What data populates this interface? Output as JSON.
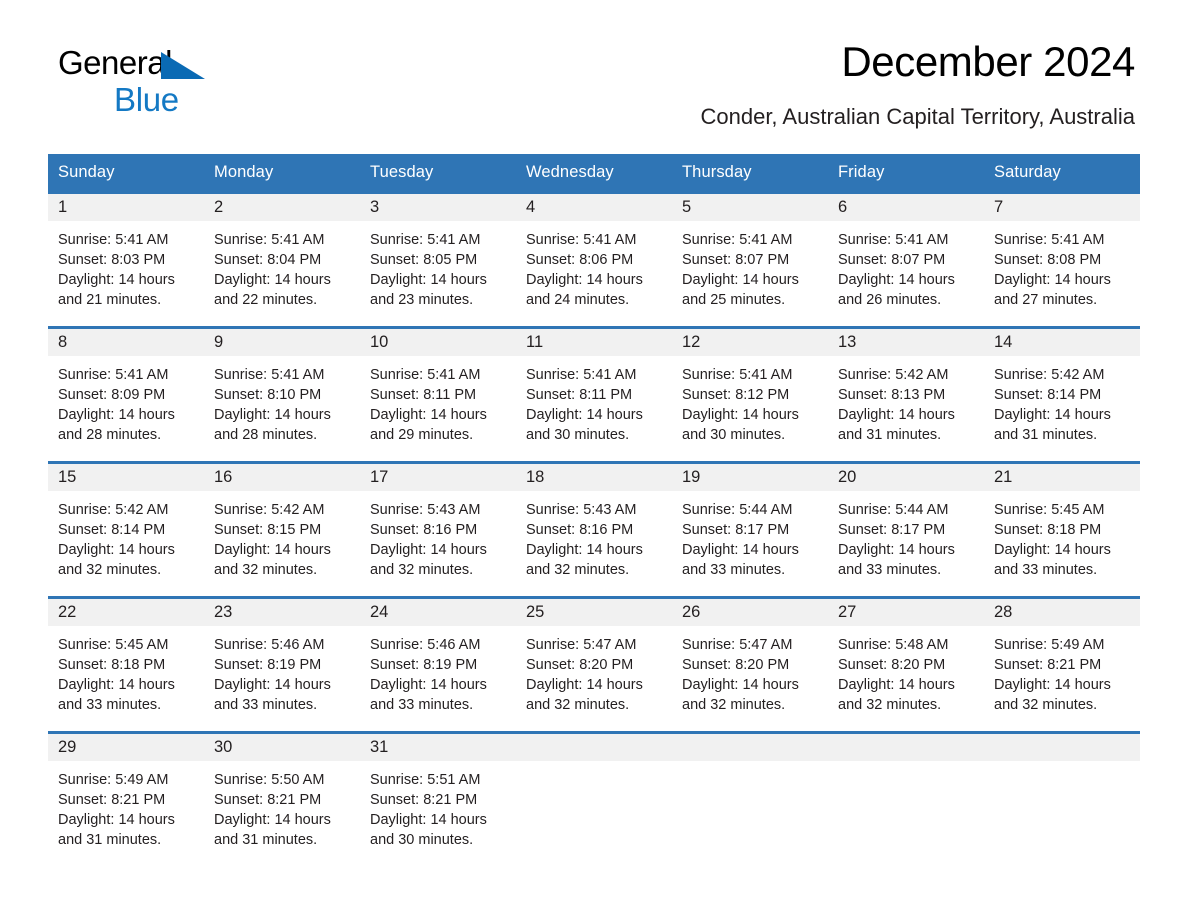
{
  "brand": {
    "name_part1": "General",
    "name_part2": "Blue",
    "accent_color": "#1479c4",
    "triangle_color": "#0a6ab4"
  },
  "header": {
    "title": "December 2024",
    "subtitle": "Conder, Australian Capital Territory, Australia",
    "header_bg_color": "#2f75b5",
    "daynum_bg_color": "#f1f1f1"
  },
  "weekday_headers": [
    "Sunday",
    "Monday",
    "Tuesday",
    "Wednesday",
    "Thursday",
    "Friday",
    "Saturday"
  ],
  "weeks": [
    [
      {
        "day": "1",
        "sunrise": "Sunrise: 5:41 AM",
        "sunset": "Sunset: 8:03 PM",
        "daylight_line1": "Daylight: 14 hours",
        "daylight_line2": "and 21 minutes."
      },
      {
        "day": "2",
        "sunrise": "Sunrise: 5:41 AM",
        "sunset": "Sunset: 8:04 PM",
        "daylight_line1": "Daylight: 14 hours",
        "daylight_line2": "and 22 minutes."
      },
      {
        "day": "3",
        "sunrise": "Sunrise: 5:41 AM",
        "sunset": "Sunset: 8:05 PM",
        "daylight_line1": "Daylight: 14 hours",
        "daylight_line2": "and 23 minutes."
      },
      {
        "day": "4",
        "sunrise": "Sunrise: 5:41 AM",
        "sunset": "Sunset: 8:06 PM",
        "daylight_line1": "Daylight: 14 hours",
        "daylight_line2": "and 24 minutes."
      },
      {
        "day": "5",
        "sunrise": "Sunrise: 5:41 AM",
        "sunset": "Sunset: 8:07 PM",
        "daylight_line1": "Daylight: 14 hours",
        "daylight_line2": "and 25 minutes."
      },
      {
        "day": "6",
        "sunrise": "Sunrise: 5:41 AM",
        "sunset": "Sunset: 8:07 PM",
        "daylight_line1": "Daylight: 14 hours",
        "daylight_line2": "and 26 minutes."
      },
      {
        "day": "7",
        "sunrise": "Sunrise: 5:41 AM",
        "sunset": "Sunset: 8:08 PM",
        "daylight_line1": "Daylight: 14 hours",
        "daylight_line2": "and 27 minutes."
      }
    ],
    [
      {
        "day": "8",
        "sunrise": "Sunrise: 5:41 AM",
        "sunset": "Sunset: 8:09 PM",
        "daylight_line1": "Daylight: 14 hours",
        "daylight_line2": "and 28 minutes."
      },
      {
        "day": "9",
        "sunrise": "Sunrise: 5:41 AM",
        "sunset": "Sunset: 8:10 PM",
        "daylight_line1": "Daylight: 14 hours",
        "daylight_line2": "and 28 minutes."
      },
      {
        "day": "10",
        "sunrise": "Sunrise: 5:41 AM",
        "sunset": "Sunset: 8:11 PM",
        "daylight_line1": "Daylight: 14 hours",
        "daylight_line2": "and 29 minutes."
      },
      {
        "day": "11",
        "sunrise": "Sunrise: 5:41 AM",
        "sunset": "Sunset: 8:11 PM",
        "daylight_line1": "Daylight: 14 hours",
        "daylight_line2": "and 30 minutes."
      },
      {
        "day": "12",
        "sunrise": "Sunrise: 5:41 AM",
        "sunset": "Sunset: 8:12 PM",
        "daylight_line1": "Daylight: 14 hours",
        "daylight_line2": "and 30 minutes."
      },
      {
        "day": "13",
        "sunrise": "Sunrise: 5:42 AM",
        "sunset": "Sunset: 8:13 PM",
        "daylight_line1": "Daylight: 14 hours",
        "daylight_line2": "and 31 minutes."
      },
      {
        "day": "14",
        "sunrise": "Sunrise: 5:42 AM",
        "sunset": "Sunset: 8:14 PM",
        "daylight_line1": "Daylight: 14 hours",
        "daylight_line2": "and 31 minutes."
      }
    ],
    [
      {
        "day": "15",
        "sunrise": "Sunrise: 5:42 AM",
        "sunset": "Sunset: 8:14 PM",
        "daylight_line1": "Daylight: 14 hours",
        "daylight_line2": "and 32 minutes."
      },
      {
        "day": "16",
        "sunrise": "Sunrise: 5:42 AM",
        "sunset": "Sunset: 8:15 PM",
        "daylight_line1": "Daylight: 14 hours",
        "daylight_line2": "and 32 minutes."
      },
      {
        "day": "17",
        "sunrise": "Sunrise: 5:43 AM",
        "sunset": "Sunset: 8:16 PM",
        "daylight_line1": "Daylight: 14 hours",
        "daylight_line2": "and 32 minutes."
      },
      {
        "day": "18",
        "sunrise": "Sunrise: 5:43 AM",
        "sunset": "Sunset: 8:16 PM",
        "daylight_line1": "Daylight: 14 hours",
        "daylight_line2": "and 32 minutes."
      },
      {
        "day": "19",
        "sunrise": "Sunrise: 5:44 AM",
        "sunset": "Sunset: 8:17 PM",
        "daylight_line1": "Daylight: 14 hours",
        "daylight_line2": "and 33 minutes."
      },
      {
        "day": "20",
        "sunrise": "Sunrise: 5:44 AM",
        "sunset": "Sunset: 8:17 PM",
        "daylight_line1": "Daylight: 14 hours",
        "daylight_line2": "and 33 minutes."
      },
      {
        "day": "21",
        "sunrise": "Sunrise: 5:45 AM",
        "sunset": "Sunset: 8:18 PM",
        "daylight_line1": "Daylight: 14 hours",
        "daylight_line2": "and 33 minutes."
      }
    ],
    [
      {
        "day": "22",
        "sunrise": "Sunrise: 5:45 AM",
        "sunset": "Sunset: 8:18 PM",
        "daylight_line1": "Daylight: 14 hours",
        "daylight_line2": "and 33 minutes."
      },
      {
        "day": "23",
        "sunrise": "Sunrise: 5:46 AM",
        "sunset": "Sunset: 8:19 PM",
        "daylight_line1": "Daylight: 14 hours",
        "daylight_line2": "and 33 minutes."
      },
      {
        "day": "24",
        "sunrise": "Sunrise: 5:46 AM",
        "sunset": "Sunset: 8:19 PM",
        "daylight_line1": "Daylight: 14 hours",
        "daylight_line2": "and 33 minutes."
      },
      {
        "day": "25",
        "sunrise": "Sunrise: 5:47 AM",
        "sunset": "Sunset: 8:20 PM",
        "daylight_line1": "Daylight: 14 hours",
        "daylight_line2": "and 32 minutes."
      },
      {
        "day": "26",
        "sunrise": "Sunrise: 5:47 AM",
        "sunset": "Sunset: 8:20 PM",
        "daylight_line1": "Daylight: 14 hours",
        "daylight_line2": "and 32 minutes."
      },
      {
        "day": "27",
        "sunrise": "Sunrise: 5:48 AM",
        "sunset": "Sunset: 8:20 PM",
        "daylight_line1": "Daylight: 14 hours",
        "daylight_line2": "and 32 minutes."
      },
      {
        "day": "28",
        "sunrise": "Sunrise: 5:49 AM",
        "sunset": "Sunset: 8:21 PM",
        "daylight_line1": "Daylight: 14 hours",
        "daylight_line2": "and 32 minutes."
      }
    ],
    [
      {
        "day": "29",
        "sunrise": "Sunrise: 5:49 AM",
        "sunset": "Sunset: 8:21 PM",
        "daylight_line1": "Daylight: 14 hours",
        "daylight_line2": "and 31 minutes."
      },
      {
        "day": "30",
        "sunrise": "Sunrise: 5:50 AM",
        "sunset": "Sunset: 8:21 PM",
        "daylight_line1": "Daylight: 14 hours",
        "daylight_line2": "and 31 minutes."
      },
      {
        "day": "31",
        "sunrise": "Sunrise: 5:51 AM",
        "sunset": "Sunset: 8:21 PM",
        "daylight_line1": "Daylight: 14 hours",
        "daylight_line2": "and 30 minutes."
      },
      {
        "day": "",
        "sunrise": "",
        "sunset": "",
        "daylight_line1": "",
        "daylight_line2": ""
      },
      {
        "day": "",
        "sunrise": "",
        "sunset": "",
        "daylight_line1": "",
        "daylight_line2": ""
      },
      {
        "day": "",
        "sunrise": "",
        "sunset": "",
        "daylight_line1": "",
        "daylight_line2": ""
      },
      {
        "day": "",
        "sunrise": "",
        "sunset": "",
        "daylight_line1": "",
        "daylight_line2": ""
      }
    ]
  ]
}
